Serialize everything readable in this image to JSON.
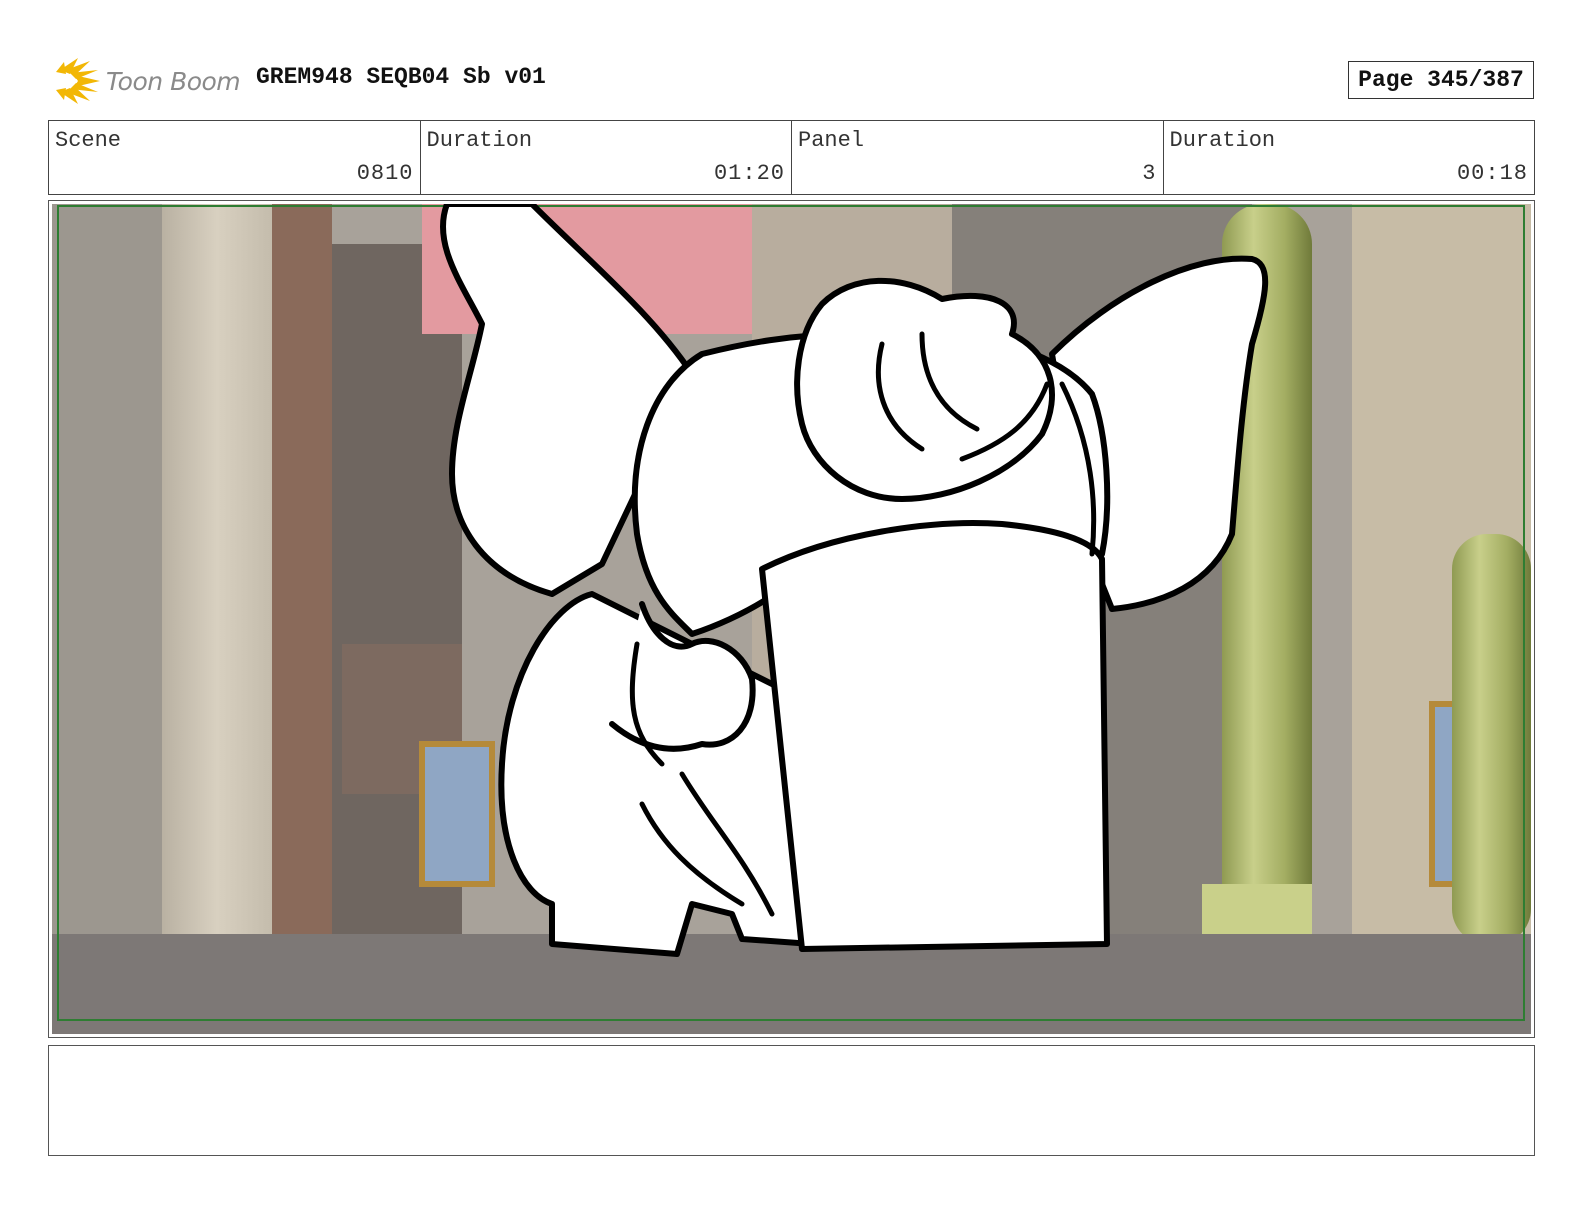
{
  "header": {
    "logo_text": "Toon Boom",
    "title": "GREM948 SEQB04 Sb v01",
    "page_label": "Page 345/387"
  },
  "info": {
    "scene_label": "Scene",
    "scene_value": "0810",
    "scene_duration_label": "Duration",
    "scene_duration_value": "01:20",
    "panel_label": "Panel",
    "panel_value": "3",
    "panel_duration_label": "Duration",
    "panel_duration_value": "00:18"
  },
  "notes": {
    "text": ""
  },
  "colors": {
    "safe_frame": "#2e7d32",
    "sky_pink": "#e39aa0",
    "pipe_green": "#a9b36b",
    "wall_beige": "#cfc6b4",
    "floor_gray": "#7d7876"
  }
}
